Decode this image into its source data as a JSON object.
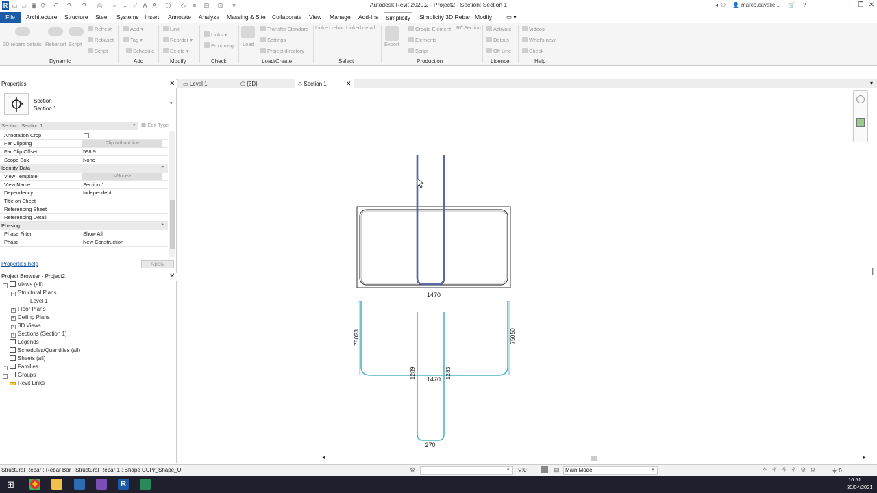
{
  "window": {
    "title": "Autodesk Revit 2020.2 - Project2 - Section: Section 1",
    "user": "marco.cavalie..."
  },
  "menu": {
    "tabs": [
      "File",
      "Architecture",
      "Structure",
      "Steel",
      "Systems",
      "Insert",
      "Annotate",
      "Analyze",
      "Massing & Site",
      "Collaborate",
      "View",
      "Manage",
      "Add-Ins",
      "Simplicity",
      "Simplicity 3D Rebar",
      "Modify"
    ],
    "active": "Simplicity"
  },
  "ribbon": {
    "panels": [
      "Dynamic",
      "Add",
      "Modify",
      "Check",
      "Load/Create",
      "Select",
      "Production",
      "Licence",
      "Help"
    ],
    "dynamic": {
      "rebars_details": "2D rebars details",
      "rebarset": "Rebarset",
      "script": "Script",
      "refresh": "Refresh",
      "rebaset": "Rebaset",
      "script2": "Script"
    },
    "add": {
      "add": "Add",
      "tag": "Tag",
      "schedule": "Schedule"
    },
    "modify": {
      "link": "Link",
      "reorder": "Reorder",
      "delete": "Delete"
    },
    "check": {
      "links": "Links",
      "error_msg": "Error msg"
    },
    "load": {
      "load": "Load",
      "transfer": "Transfer Standard",
      "settings": "Settings",
      "project_dir": "Project directory"
    },
    "select": {
      "linked_rebar": "Linked rebar",
      "linked_detail": "Linked detail"
    },
    "production": {
      "export": "Export",
      "create_element": "Create Element",
      "rcsection": "RCSection",
      "elements": "Elements",
      "script": "Script"
    },
    "licence": {
      "activate": "Activate",
      "details": "Details",
      "offline": "Off Line"
    },
    "help": {
      "videos": "Videos",
      "whats_new": "What's new",
      "check": "Check"
    }
  },
  "properties": {
    "title": "Properties",
    "type_line1": "Section",
    "type_line2": "Section 1",
    "selector": "Section: Section 1",
    "edit_type": "Edit Type",
    "rows": [
      {
        "k": "Annotation Crop",
        "v": ""
      },
      {
        "k": "Far Clipping",
        "v": "Clip without line"
      },
      {
        "k": "Far Clip Offset",
        "v": "598.9"
      },
      {
        "k": "Scope Box",
        "v": "None"
      }
    ],
    "group_identity": "Identity Data",
    "identity_rows": [
      {
        "k": "View Template",
        "v": "<None>"
      },
      {
        "k": "View Name",
        "v": "Section 1"
      },
      {
        "k": "Dependency",
        "v": "Independent"
      },
      {
        "k": "Title on Sheet",
        "v": ""
      },
      {
        "k": "Referencing Sheet",
        "v": ""
      },
      {
        "k": "Referencing Detail",
        "v": ""
      }
    ],
    "group_phasing": "Phasing",
    "phasing_rows": [
      {
        "k": "Phase Filter",
        "v": "Show All"
      },
      {
        "k": "Phase",
        "v": "New Construction"
      }
    ],
    "help_link": "Properties help",
    "apply": "Apply"
  },
  "browser": {
    "title": "Project Browser - Project2",
    "items": [
      "Views (all)",
      "Structural Plans",
      "Level 1",
      "Floor Plans",
      "Ceiling Plans",
      "3D Views",
      "Sections (Section 1)",
      "Legends",
      "Schedules/Quantities (all)",
      "Sheets (all)",
      "Families",
      "Groups",
      "Revit Links"
    ]
  },
  "viewtabs": [
    "Level 1",
    "{3D}",
    "Section 1"
  ],
  "drawing": {
    "dim_top": "1470",
    "dim_bottom_w": "1470",
    "dim_left": "75023",
    "dim_right": "75050",
    "dim_u_left": "1289",
    "dim_u_right": "1283",
    "dim_u_bottom": "270"
  },
  "status": {
    "left": "Structural Rebar : Rebar Bar : Structural Rebar 1 : Shape CCPr_Shape_U",
    "count": ":0",
    "model": "Main Model",
    "filter": ":0"
  },
  "taskbar": {
    "time": "16:51",
    "date": "30/04/2021"
  }
}
